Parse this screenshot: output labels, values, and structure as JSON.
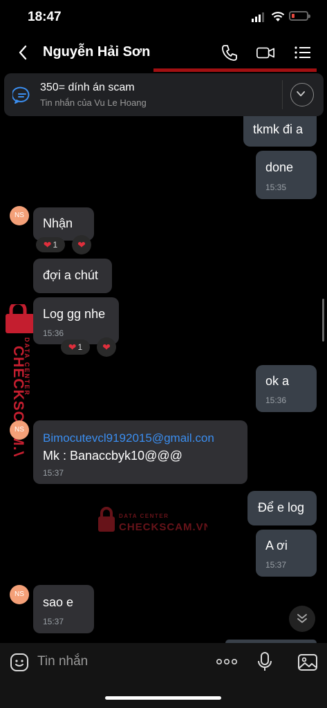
{
  "status": {
    "time": "18:47"
  },
  "header": {
    "title": "Nguyễn Hải Sơn"
  },
  "pinned": {
    "title": "350= dính án scam",
    "subtitle": "Tin nhắn của Vu Le Hoang"
  },
  "messages": [
    {
      "text": "tkmk đi a"
    },
    {
      "text": "done",
      "time": "15:35"
    },
    {
      "avatar": "NS",
      "text": "Nhận",
      "reaction_count": "1"
    },
    {
      "text": "đợi a chút"
    },
    {
      "text": "Log gg nhe",
      "time": "15:36",
      "reaction_count": "1"
    },
    {
      "text": "ok a",
      "time": "15:36"
    },
    {
      "avatar": "NS",
      "email": "Bimocutevcl9192015@gmail.con",
      "text": "Mk : Banaccbyk10@@@",
      "time": "15:37"
    },
    {
      "text": "Để e log"
    },
    {
      "text": "A ơi",
      "time": "15:37"
    },
    {
      "avatar": "NS",
      "text": "sao e",
      "time": "15:37"
    }
  ],
  "watermark": {
    "brand": "CHECKSCAM.VN",
    "tag": "DATA CENTER"
  },
  "input": {
    "placeholder": "Tin nhắn"
  },
  "colors": {
    "outgoing_bubble": "#394049",
    "incoming_bubble": "#303034",
    "link": "#3b8ef0",
    "heart": "#e02f3c",
    "avatar": "#f4a078"
  }
}
